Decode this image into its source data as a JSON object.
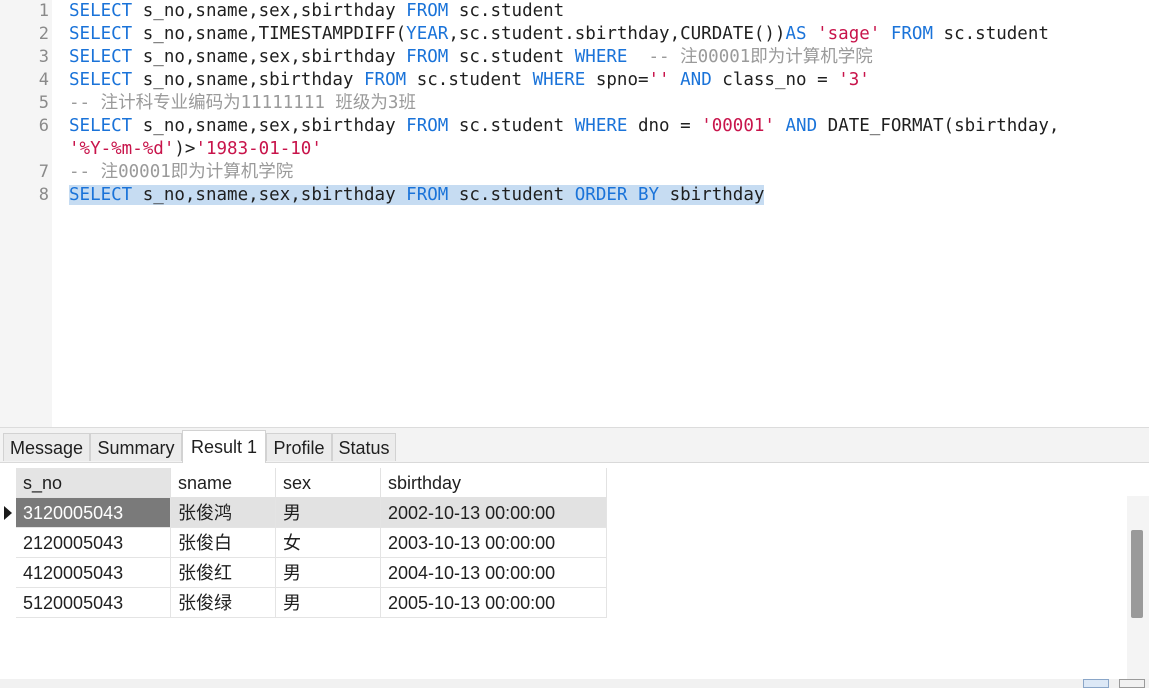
{
  "editor": {
    "line_numbers": [
      "1",
      "2",
      "3",
      "4",
      "5",
      "6",
      "",
      "7",
      "8"
    ],
    "lines": [
      [
        {
          "t": "SELECT",
          "c": "kw"
        },
        {
          "t": " s_no,sname,sex,sbirthday ",
          "c": ""
        },
        {
          "t": "FROM",
          "c": "kw"
        },
        {
          "t": " sc.student",
          "c": ""
        }
      ],
      [
        {
          "t": "SELECT",
          "c": "kw"
        },
        {
          "t": " s_no,sname,TIMESTAMPDIFF(",
          "c": ""
        },
        {
          "t": "YEAR",
          "c": "kw"
        },
        {
          "t": ",sc.student.sbirthday,CURDATE())",
          "c": ""
        },
        {
          "t": "AS",
          "c": "kw"
        },
        {
          "t": " ",
          "c": ""
        },
        {
          "t": "'sage'",
          "c": "str"
        },
        {
          "t": " ",
          "c": ""
        },
        {
          "t": "FROM",
          "c": "kw"
        },
        {
          "t": " sc.student",
          "c": ""
        }
      ],
      [
        {
          "t": "SELECT",
          "c": "kw"
        },
        {
          "t": " s_no,sname,sex,sbirthday ",
          "c": ""
        },
        {
          "t": "FROM",
          "c": "kw"
        },
        {
          "t": " sc.student ",
          "c": ""
        },
        {
          "t": "WHERE",
          "c": "kw"
        },
        {
          "t": "  ",
          "c": ""
        },
        {
          "t": "-- 注00001即为计算机学院",
          "c": "cm"
        }
      ],
      [
        {
          "t": "SELECT",
          "c": "kw"
        },
        {
          "t": " s_no,sname,sbirthday ",
          "c": ""
        },
        {
          "t": "FROM",
          "c": "kw"
        },
        {
          "t": " sc.student ",
          "c": ""
        },
        {
          "t": "WHERE",
          "c": "kw"
        },
        {
          "t": " spno=",
          "c": ""
        },
        {
          "t": "''",
          "c": "str"
        },
        {
          "t": " ",
          "c": ""
        },
        {
          "t": "AND",
          "c": "kw"
        },
        {
          "t": " class_no = ",
          "c": ""
        },
        {
          "t": "'3'",
          "c": "str"
        }
      ],
      [
        {
          "t": "-- 注计科专业编码为11111111 班级为3班",
          "c": "cm"
        }
      ],
      [
        {
          "t": "SELECT",
          "c": "kw"
        },
        {
          "t": " s_no,sname,sex,sbirthday ",
          "c": ""
        },
        {
          "t": "FROM",
          "c": "kw"
        },
        {
          "t": " sc.student ",
          "c": ""
        },
        {
          "t": "WHERE",
          "c": "kw"
        },
        {
          "t": " dno = ",
          "c": ""
        },
        {
          "t": "'00001'",
          "c": "str"
        },
        {
          "t": " ",
          "c": ""
        },
        {
          "t": "AND",
          "c": "kw"
        },
        {
          "t": " DATE_FORMAT(sbirthday,",
          "c": ""
        }
      ],
      [
        {
          "t": "'%Y-%m-%d'",
          "c": "str"
        },
        {
          "t": ")>",
          "c": ""
        },
        {
          "t": "'1983-01-10'",
          "c": "str"
        }
      ],
      [
        {
          "t": "-- 注00001即为计算机学院",
          "c": "cm"
        }
      ],
      [
        {
          "t": "SELECT",
          "c": "kw sel"
        },
        {
          "t": " s_no,sname,sex,sbirthday ",
          "c": "sel"
        },
        {
          "t": "FROM",
          "c": "kw sel"
        },
        {
          "t": " sc.student ",
          "c": "sel"
        },
        {
          "t": "ORDER BY",
          "c": "kw sel"
        },
        {
          "t": " sbirthday",
          "c": "sel"
        }
      ]
    ]
  },
  "results": {
    "tabs": [
      "Message",
      "Summary",
      "Result 1",
      "Profile",
      "Status"
    ],
    "active_tab": "Result 1",
    "columns": [
      "s_no",
      "sname",
      "sex",
      "sbirthday"
    ],
    "rows": [
      [
        "3120005043",
        "张俊鸿",
        "男",
        "2002-10-13 00:00:00"
      ],
      [
        "2120005043",
        "张俊白",
        "女",
        "2003-10-13 00:00:00"
      ],
      [
        "4120005043",
        "张俊红",
        "男",
        "2004-10-13 00:00:00"
      ],
      [
        "5120005043",
        "张俊绿",
        "男",
        "2005-10-13 00:00:00"
      ]
    ],
    "current_row": 0
  },
  "colors": {
    "keyword": "#1a73d9",
    "string": "#c8144b",
    "comment": "#9a9a9a",
    "selection": "#c6dcf2"
  }
}
